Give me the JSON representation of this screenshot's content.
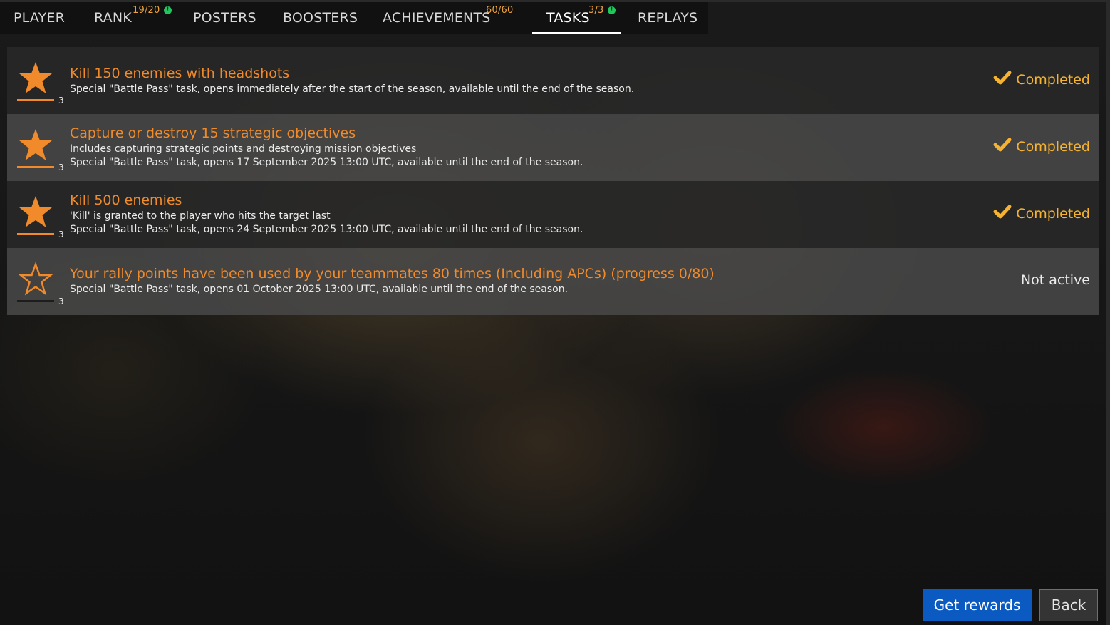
{
  "tabs": [
    {
      "label": "PLAYER"
    },
    {
      "label": "RANK",
      "badge": "19/20",
      "notice": "!"
    },
    {
      "label": "POSTERS"
    },
    {
      "label": "BOOSTERS"
    },
    {
      "label": "ACHIEVEMENTS",
      "badge": "60/60"
    },
    {
      "label": "TASKS",
      "badge": "3/3",
      "notice": "!",
      "active": true
    },
    {
      "label": "REPLAYS"
    }
  ],
  "tasks": [
    {
      "title": "Kill 150 enemies with headshots",
      "lines": [
        "Special \"Battle Pass\" task, opens immediately after the start of the season, available until the end of the season."
      ],
      "stars": "3",
      "icon": "star-filled-icon",
      "status": "Completed"
    },
    {
      "title": "Capture or destroy 15 strategic objectives",
      "lines": [
        "Includes capturing strategic points and destroying mission objectives",
        "Special \"Battle Pass\" task, opens 17 September 2025 13:00 UTC, available until the end of the season."
      ],
      "stars": "3",
      "icon": "star-filled-icon",
      "status": "Completed"
    },
    {
      "title": "Kill 500 enemies",
      "lines": [
        "'Kill' is granted to the player who hits the target last",
        "Special \"Battle Pass\" task, opens 24 September 2025 13:00 UTC, available until the end of the season."
      ],
      "stars": "3",
      "icon": "star-filled-icon",
      "status": "Completed"
    },
    {
      "title": "Your rally points have been used by your teammates 80 times (Including APCs) (progress 0/80)",
      "lines": [
        "Special \"Battle Pass\" task, opens 01 October 2025 13:00 UTC, available until the end of the season."
      ],
      "stars": "3",
      "icon": "star-outline-icon",
      "status": "Not active"
    }
  ],
  "buttons": {
    "get_rewards": "Get rewards",
    "back": "Back"
  },
  "colors": {
    "accent": "#f08a2a",
    "completed": "#f6b332",
    "notice": "#22c55e",
    "primary_button": "#0b5ac2"
  }
}
